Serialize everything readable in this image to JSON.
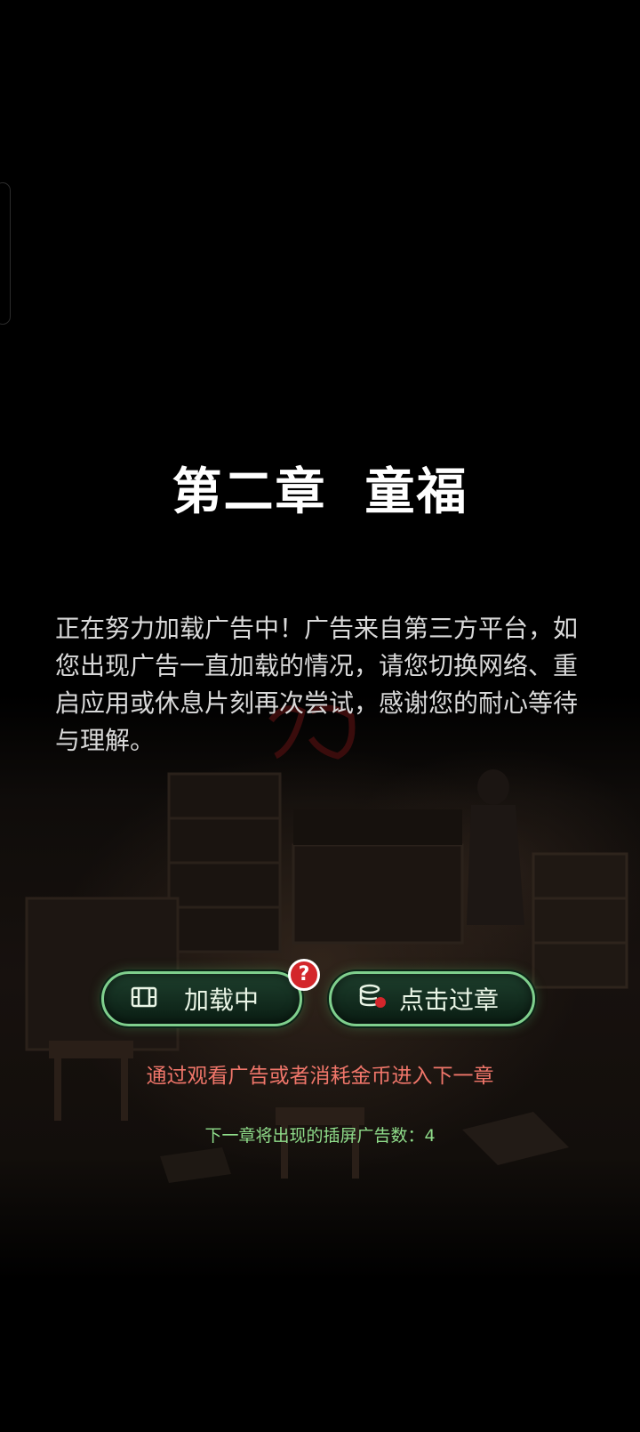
{
  "chapter": {
    "title": "第二章  童福"
  },
  "notice": {
    "text": "正在努力加载广告中！广告来自第三方平台，如您出现广告一直加载的情况，请您切换网络、重启应用或休息片刻再次尝试，感谢您的耐心等待与理解。"
  },
  "buttons": {
    "loading": {
      "label": "加载中",
      "icon": "video-film-icon"
    },
    "skip": {
      "label": "点击过章",
      "icon": "coin-stack-icon"
    },
    "help": {
      "label": "?",
      "icon": "help-question-icon"
    }
  },
  "hints": {
    "primary": "通过观看广告或者消耗金币进入下一章",
    "ad_count": "下一章将出现的插屏广告数：4"
  },
  "colors": {
    "button_border": "#7fcf8d",
    "hint_primary": "#f0766a",
    "hint_secondary": "#8fdc8a",
    "help_badge": "#d3262b"
  }
}
